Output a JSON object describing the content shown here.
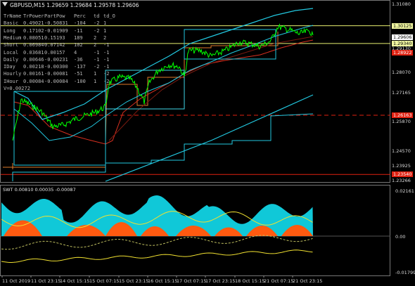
{
  "header": {
    "symbol_line": "GBPUSD,M15  1.29659 1.29684 1.29578 1.29606"
  },
  "table": {
    "header": [
      "TrName",
      "TrPower",
      "PartPow",
      "Perc",
      "td",
      "td_O"
    ],
    "rows": [
      [
        "Basic",
        "0.49021",
        "-0.50831",
        "-104",
        "-2",
        "1"
      ],
      [
        "Long",
        "0.17102",
        "-0.01909",
        "-11",
        "-2",
        "1"
      ],
      [
        "Medium",
        "0.08051",
        "0.15193",
        "189",
        "2",
        "2"
      ],
      [
        "Short",
        "0.06984",
        "0.07142",
        "102",
        "2",
        "-1"
      ],
      [
        "Local",
        "0.03681",
        "0.00157",
        "4",
        "-1",
        "-1"
      ],
      [
        "Daily",
        "0.00646",
        "-0.00231",
        "-36",
        "-1",
        "-1"
      ],
      [
        "IDay",
        "0.00218",
        "-0.00300",
        "-137",
        "-2",
        "-1"
      ],
      [
        "Hourly",
        "0.00161",
        "-0.00081",
        "-51",
        "1",
        "-2"
      ],
      [
        "IHour",
        "0.00084",
        "-0.00084",
        "-100",
        "1",
        "-2"
      ]
    ],
    "footer": "V=0.00272"
  },
  "price_axis": [
    "1.31080",
    "1.30125",
    "1.29606",
    "1.29340",
    "1.29130",
    "1.28922",
    "1.28070",
    "1.27165",
    "1.26163",
    "1.25870",
    "1.24570",
    "1.23925",
    "1.23540",
    "1.23266"
  ],
  "indicator": {
    "label": "SWT 0.00810 0.00035 -0.00087",
    "axis": [
      "0.02161",
      "0.00",
      "-0.01799"
    ]
  },
  "time_axis": [
    "11 Oct 2019",
    "11 Oct 23:15",
    "14 Oct 15:15",
    "15 Oct 07:15",
    "15 Oct 23:15",
    "16 Oct 15:15",
    "17 Oct 07:15",
    "17 Oct 23:15",
    "18 Oct 15:15",
    "21 Oct 07:15",
    "21 Oct 23:15"
  ],
  "colors": {
    "background": "#000000",
    "price_line": "#00ff00",
    "channel_cyan": "#22c8e0",
    "orange_step": "#e07a2a",
    "red_line": "#d83020",
    "yellow_green_level": "#e8f070",
    "red_tag": "#e02010",
    "indicator_cyan": "#10c8d8",
    "indicator_orange": "#ff5a10",
    "indicator_yellow": "#f0e030"
  }
}
